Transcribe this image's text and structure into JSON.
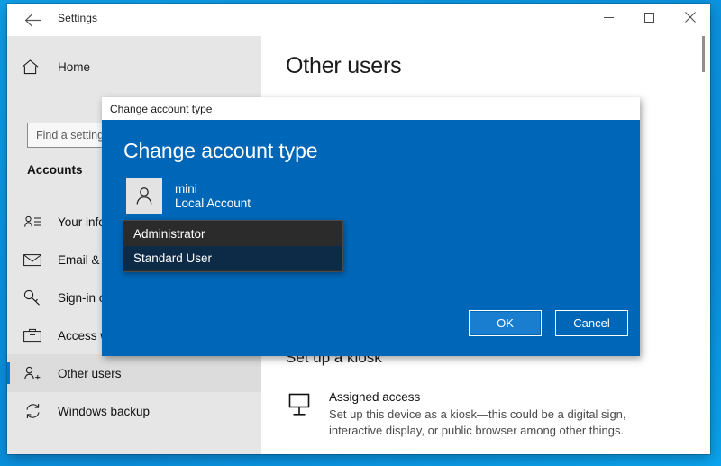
{
  "desktop": {
    "background_color": "#0b93e0"
  },
  "settings_window": {
    "titlebar": {
      "back_icon": "back-arrow-icon",
      "title": "Settings",
      "minimize_label": "—",
      "maximize_label": "□",
      "close_label": "✕"
    },
    "sidebar": {
      "home_icon": "home-icon",
      "home_label": "Home",
      "search": {
        "placeholder": "Find a setting",
        "value": ""
      },
      "section_title": "Accounts",
      "items": [
        {
          "label": "Your info",
          "icon": "person-details-icon",
          "selected": false
        },
        {
          "label": "Email & accounts",
          "icon": "envelope-icon",
          "selected": false
        },
        {
          "label": "Sign-in options",
          "icon": "key-icon",
          "selected": false
        },
        {
          "label": "Access work or school",
          "icon": "briefcase-icon",
          "selected": false
        },
        {
          "label": "Other users",
          "icon": "person-plus-icon",
          "selected": true
        },
        {
          "label": "Windows backup",
          "icon": "sync-icon",
          "selected": false
        }
      ]
    },
    "content": {
      "page_title": "Other users",
      "kiosk_heading": "Set up a kiosk",
      "assigned_access": {
        "icon": "kiosk-display-icon",
        "title": "Assigned access",
        "description": "Set up this device as a kiosk—this could be a digital sign, interactive display, or public browser among other things."
      }
    }
  },
  "dialog": {
    "titlebar_title": "Change account type",
    "heading": "Change account type",
    "user": {
      "avatar_icon": "person-avatar-icon",
      "name": "mini",
      "account_type": "Local Account"
    },
    "account_type_dropdown": {
      "expanded": true,
      "selected": "Standard User",
      "options": [
        {
          "label": "Administrator",
          "selected": false
        },
        {
          "label": "Standard User",
          "selected": true
        }
      ]
    },
    "buttons": {
      "ok": "OK",
      "cancel": "Cancel"
    },
    "colors": {
      "dialog_blue": "#0067b8",
      "dropdown_bg": "#2b2b2b",
      "dropdown_highlight": "#0d2a47",
      "ok_button_fill": "#1a7ed0"
    }
  }
}
